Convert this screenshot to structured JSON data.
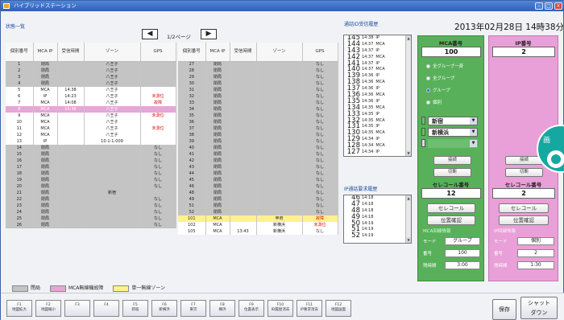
{
  "app": {
    "title": "ハイブリッドステーション"
  },
  "main": {
    "title": "状態一覧",
    "page": "1/2ページ",
    "prev": "◀",
    "next": "▶"
  },
  "table": {
    "headers": [
      "個別番号",
      "MCA IP",
      "受信時間",
      "ゾーン",
      "GPS"
    ],
    "left": [
      [
        "1",
        "閉局",
        "",
        "八王子",
        ""
      ],
      [
        "2",
        "閉局",
        "",
        "八王子",
        ""
      ],
      [
        "3",
        "閉局",
        "",
        "八王子",
        ""
      ],
      [
        "4",
        "閉局",
        "",
        "八王子",
        ""
      ],
      [
        "5",
        "MCA",
        "14:38",
        "八王子",
        ""
      ],
      [
        "6",
        "IP",
        "14:23",
        "八王子",
        "未測位"
      ],
      [
        "7",
        "MCA",
        "14:08",
        "八王子",
        "故障"
      ],
      [
        "8",
        "MCA",
        "15:36",
        "八王子",
        ""
      ],
      [
        "9",
        "MCA",
        "",
        "八王子",
        "未測位"
      ],
      [
        "10",
        "MCA",
        "",
        "八王子",
        ""
      ],
      [
        "11",
        "MCA",
        "",
        "八王子",
        "未測位"
      ],
      [
        "12",
        "MCA",
        "",
        "八王子",
        ""
      ],
      [
        "13",
        "IP",
        "",
        "10-1-1-009",
        ""
      ],
      [
        "14",
        "閉局",
        "",
        "",
        "なし"
      ],
      [
        "15",
        "閉局",
        "",
        "",
        "なし"
      ],
      [
        "16",
        "閉局",
        "",
        "",
        "なし"
      ],
      [
        "17",
        "閉局",
        "",
        "",
        "なし"
      ],
      [
        "18",
        "閉局",
        "",
        "",
        "なし"
      ],
      [
        "19",
        "閉局",
        "",
        "",
        "なし"
      ],
      [
        "20",
        "閉局",
        "",
        "",
        "なし"
      ],
      [
        "21",
        "閉局",
        "",
        "新宿",
        ""
      ],
      [
        "22",
        "閉局",
        "",
        "",
        "なし"
      ],
      [
        "23",
        "閉局",
        "",
        "",
        "なし"
      ],
      [
        "24",
        "閉局",
        "",
        "",
        "なし"
      ],
      [
        "25",
        "閉局",
        "",
        "",
        "なし"
      ],
      [
        "26",
        "閉局",
        "",
        "",
        "なし"
      ]
    ],
    "right": [
      [
        "27",
        "閉局",
        "",
        "",
        "なし"
      ],
      [
        "28",
        "閉局",
        "",
        "",
        "なし"
      ],
      [
        "29",
        "閉局",
        "",
        "",
        "なし"
      ],
      [
        "30",
        "閉局",
        "",
        "",
        "なし"
      ],
      [
        "31",
        "閉局",
        "",
        "",
        "なし"
      ],
      [
        "32",
        "閉局",
        "",
        "",
        "なし"
      ],
      [
        "33",
        "閉局",
        "",
        "",
        "なし"
      ],
      [
        "34",
        "閉局",
        "",
        "",
        "なし"
      ],
      [
        "35",
        "閉局",
        "",
        "",
        "なし"
      ],
      [
        "36",
        "閉局",
        "",
        "",
        "なし"
      ],
      [
        "37",
        "閉局",
        "",
        "",
        "なし"
      ],
      [
        "38",
        "閉局",
        "",
        "",
        "なし"
      ],
      [
        "39",
        "閉局",
        "",
        "",
        "なし"
      ],
      [
        "40",
        "閉局",
        "",
        "",
        "なし"
      ],
      [
        "41",
        "閉局",
        "",
        "",
        "なし"
      ],
      [
        "42",
        "閉局",
        "",
        "",
        "なし"
      ],
      [
        "43",
        "閉局",
        "",
        "",
        "なし"
      ],
      [
        "44",
        "閉局",
        "",
        "",
        "なし"
      ],
      [
        "45",
        "閉局",
        "",
        "",
        "なし"
      ],
      [
        "46",
        "閉局",
        "",
        "",
        "なし"
      ],
      [
        "48",
        "閉局",
        "",
        "",
        "なし"
      ],
      [
        "49",
        "閉局",
        "",
        "",
        "なし"
      ],
      [
        "51",
        "閉局",
        "",
        "",
        "なし"
      ],
      [
        "52",
        "閉局",
        "",
        "",
        "なし"
      ],
      [
        "101",
        "MCA",
        "",
        "甲府",
        "故障"
      ],
      [
        "102",
        "MCA",
        "",
        "新横浜",
        "未測位"
      ],
      [
        "105",
        "MCA",
        "13:43",
        "新横浜",
        "なし"
      ]
    ]
  },
  "legend": {
    "closed": "閉局",
    "fault": "MCA無線機故障",
    "single": "単一無線ゾーン"
  },
  "id_history": {
    "title": "通話ID受信履歴",
    "items": [
      [
        "145",
        "14:38",
        "IP"
      ],
      [
        "144",
        "14:37",
        "MCA"
      ],
      [
        "143",
        "14:37",
        "IP"
      ],
      [
        "142",
        "14:37",
        "MCA"
      ],
      [
        "141",
        "14:37",
        "IP"
      ],
      [
        "140",
        "14:37",
        "MCA"
      ],
      [
        "139",
        "14:36",
        "IP"
      ],
      [
        "138",
        "14:36",
        "MCA"
      ],
      [
        "137",
        "14:36",
        "IP"
      ],
      [
        "136",
        "14:36",
        "MCA"
      ],
      [
        "135",
        "14:36",
        "IP"
      ],
      [
        "134",
        "14:35",
        "MCA"
      ],
      [
        "133",
        "14:35",
        "IP"
      ],
      [
        "132",
        "14:35",
        "MCA"
      ],
      [
        "131",
        "14:35",
        "IP"
      ],
      [
        "130",
        "14:35",
        "MCA"
      ],
      [
        "129",
        "14:34",
        "IP"
      ],
      [
        "128",
        "14:34",
        "MCA"
      ],
      [
        "127",
        "14:34",
        "IP"
      ]
    ]
  },
  "ip_history": {
    "title": "IP通話要求履歴",
    "items": [
      [
        "46",
        "14:18"
      ],
      [
        "47",
        "14:18"
      ],
      [
        "48",
        "14:18"
      ],
      [
        "49",
        "14:18"
      ],
      [
        "50",
        "14:19"
      ],
      [
        "51",
        "14:19"
      ],
      [
        "52",
        "14:19"
      ]
    ]
  },
  "datetime": "2013年02月28日 14時38分",
  "mca": {
    "title": "MCA番号",
    "number": "100",
    "radios": [
      "全グループ一斉",
      "全グループ",
      "グループ",
      "個別"
    ],
    "zone1": "新宿",
    "zone2": "新横浜",
    "connect": "接続",
    "disconnect": "切断",
    "selcall_title": "セレコール番号",
    "selcall_number": "12",
    "selcall": "セレコール",
    "position": "位置確認",
    "status_title": "MCA回線情報",
    "mode_label": "モード",
    "mode_value": "グループ",
    "num_label": "番号",
    "num_value": "100",
    "timer_label": "残時間",
    "timer_value": "3:00"
  },
  "ip": {
    "title": "IP番号",
    "number": "2",
    "connect": "接続",
    "disconnect": "切断",
    "selcall_title": "セレコール番号",
    "selcall_number": "2",
    "selcall": "セレコール",
    "position": "位置確認",
    "status_title": "IP回線情報",
    "mode_label": "モード",
    "mode_value": "個別",
    "num_label": "番号",
    "num_value": "2",
    "timer_label": "残時間",
    "timer_value": "1:30"
  },
  "overlay": {
    "text": "画"
  },
  "fkeys": [
    [
      "F1",
      "地図拡大"
    ],
    [
      "F2",
      "地図縮小"
    ],
    [
      "F3",
      ""
    ],
    [
      "F4",
      ""
    ],
    [
      "F5",
      "新宿"
    ],
    [
      "F6",
      "新横浜"
    ],
    [
      "F7",
      "東京"
    ],
    [
      "F8",
      "横浜"
    ],
    [
      "F9",
      "位置表示"
    ],
    [
      "F10",
      "ID履歴消去"
    ],
    [
      "F11",
      "IP要求消去"
    ],
    [
      "F12",
      "地図画面"
    ]
  ],
  "buttons": {
    "save": "保存",
    "shutdown_1": "シャット",
    "shutdown_2": "ダウン"
  },
  "colors": {
    "closed": "#c4c4c4",
    "fault": "#e7a6d6",
    "single": "#fff28a",
    "mca_panel": "#58b15a",
    "ip_panel": "#e99fd7"
  }
}
